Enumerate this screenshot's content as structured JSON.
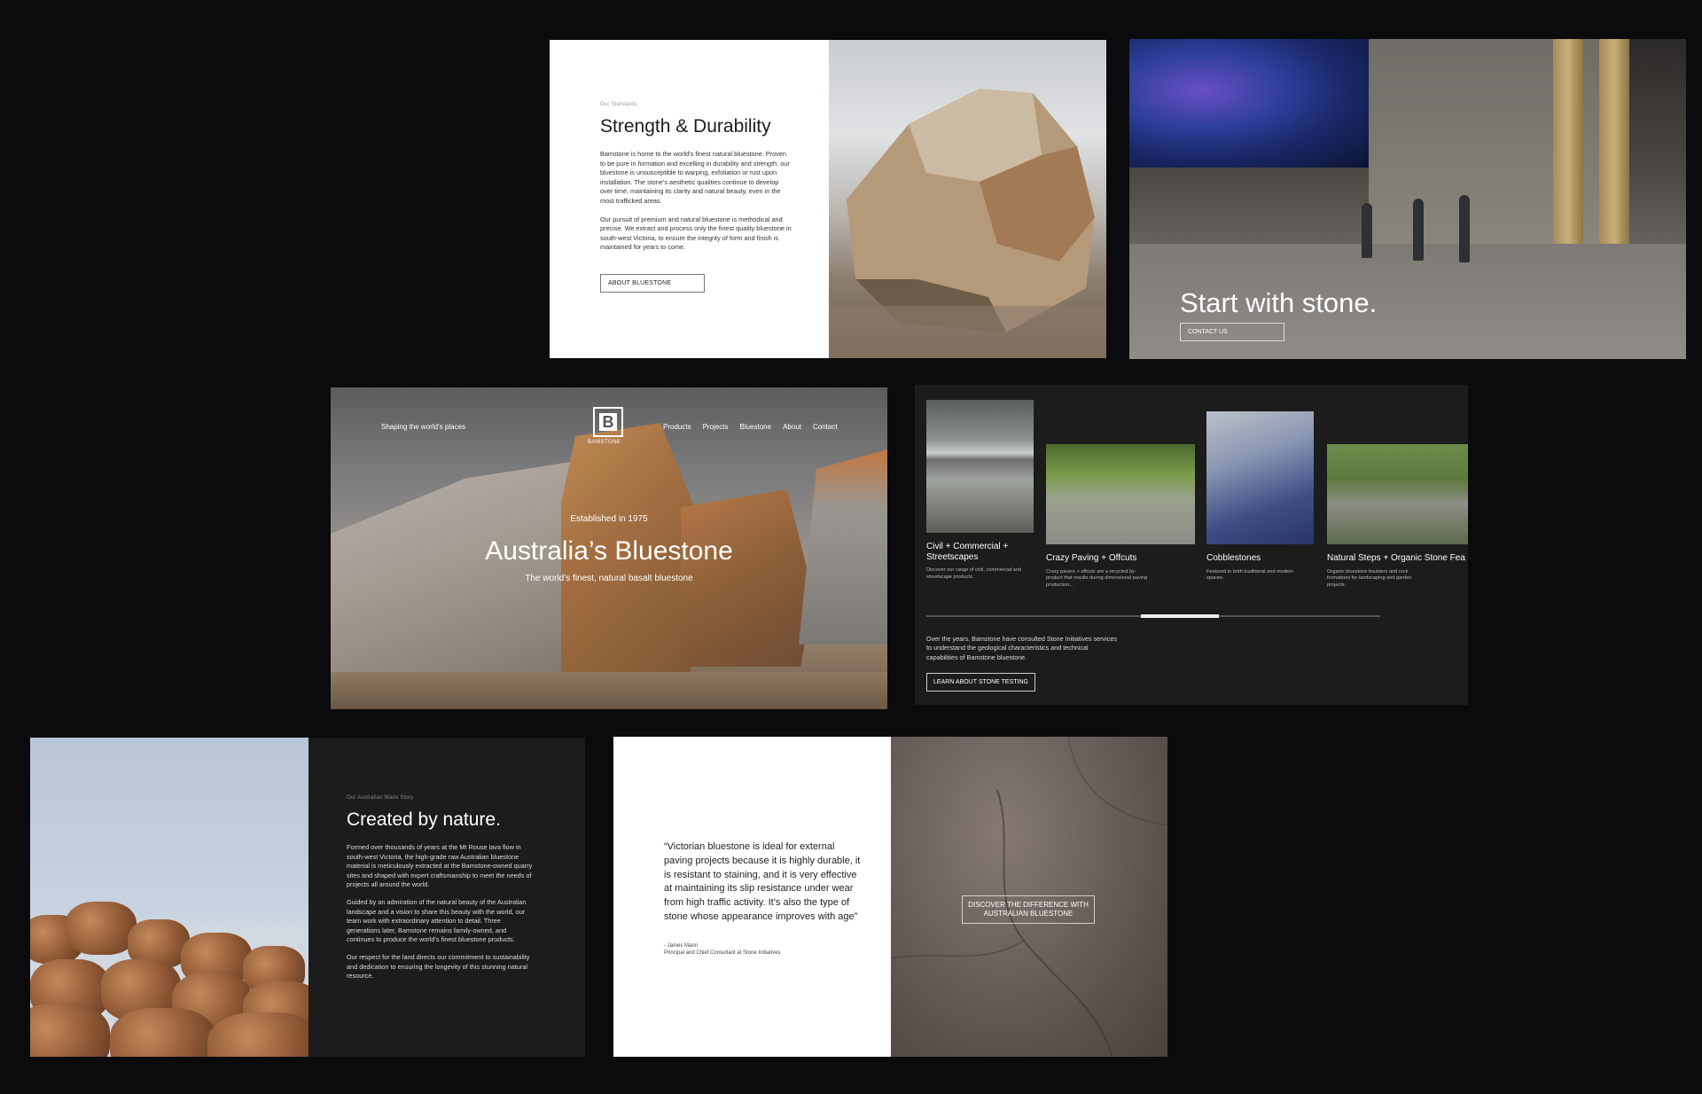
{
  "strength": {
    "eyebrow": "Our Standards",
    "title": "Strength & Durability",
    "p1": "Bamstone is home to the world’s finest natural bluestone. Proven to be pure in formation and excelling in durability and strength, our bluestone is unsusceptible to warping, exfoliation or rust upon installation. The stone’s aesthetic qualities continue to develop over time, maintaining its clarity and natural beauty, even in the most trafficked areas.",
    "p2": "Our pursuit of premium and natural bluestone is methodical and precise. We extract and process only the finest quality bluestone in south-west Victoria, to ensure the integrity of form and finish is maintained for years to come.",
    "button": "ABOUT BLUESTONE"
  },
  "start": {
    "title": "Start with stone.",
    "button": "CONTACT US"
  },
  "hero": {
    "tagline": "Shaping the world’s places",
    "logo_letter": "B",
    "logo_word": "BAMSTONE",
    "nav": [
      "Products",
      "Projects",
      "Bluestone",
      "About",
      "Contact"
    ],
    "established": "Established in 1975",
    "title": "Australia’s Bluestone",
    "subtitle": "The world’s finest, natural basalt bluestone"
  },
  "products": {
    "cards": [
      {
        "title": "Civil + Commercial + Streetscapes",
        "desc": "Discover our range of civil, commercial and streetscape products."
      },
      {
        "title": "Crazy Paving + Offcuts",
        "desc": "Crazy pavers + offcuts are a recycled by-product that results during dimensional paving production..."
      },
      {
        "title": "Cobblestones",
        "desc": "Featured in both traditional and modern spaces."
      },
      {
        "title": "Natural Steps + Organic Stone Fea",
        "desc": "Organic bluestone boulders and rock formations for landscaping and garden projects."
      }
    ],
    "body": "Over the years, Bamstone have consulted Stone Initiatives services to understand the geological characteristics and technical capabilities of Bamstone bluestone.",
    "button": "LEARN ABOUT STONE TESTING"
  },
  "nature": {
    "eyebrow": "Our Australian Made Story",
    "title": "Created by nature.",
    "p1": "Formed over thousands of years at the Mt Rouse lava flow in south-west Victoria, the high-grade raw Australian bluestone material is meticulously extracted at the Bamstone-owned quarry sites and shaped with expert craftsmanship to meet the needs of projects all around the world.",
    "p2": "Guided by an admiration of the natural beauty of the Australian landscape and a vision to share this beauty with the world, our team work with extraordinary attention to detail. Three generations later, Bamstone remains family-owned, and continues to produce the world’s finest bluestone products.",
    "p3": "Our respect for the land directs our commitment to sustainability and dedication to ensuring the longevity of this stunning natural resource."
  },
  "quote": {
    "text": "“Victorian bluestone is ideal for external paving projects because it is highly durable, it is resistant to staining, and it is very effective at maintaining its slip resistance under wear from high traffic activity. It’s also the type of stone whose appearance improves with age”",
    "author": "- James Mann",
    "role": "Principal and Chief Consultant at Stone Initiatives",
    "button": "DISCOVER THE DIFFERENCE WITH AUSTRALIAN BLUESTONE"
  }
}
